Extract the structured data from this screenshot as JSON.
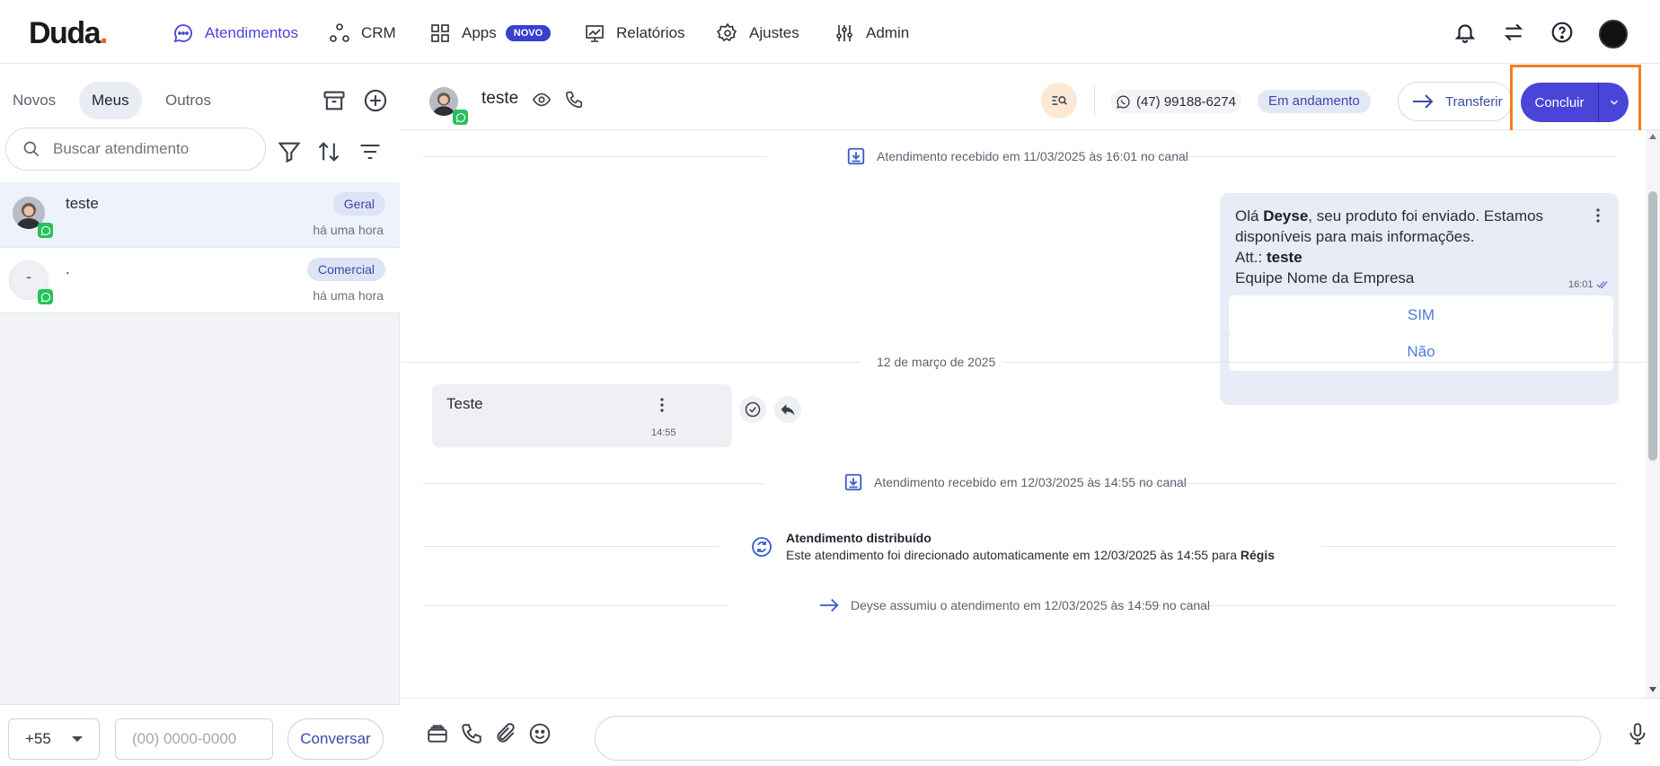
{
  "brand": {
    "name": "Duda",
    "dot": "."
  },
  "nav": {
    "atendimentos": "Atendimentos",
    "crm": "CRM",
    "apps": "Apps",
    "apps_badge": "NOVO",
    "relatorios": "Relatórios",
    "ajustes": "Ajustes",
    "admin": "Admin"
  },
  "colors": {
    "accent": "#4a45d9",
    "whatsapp": "#27c25b",
    "highlight": "#f47b20"
  },
  "sidebar": {
    "tabs": [
      "Novos",
      "Meus",
      "Outros"
    ],
    "active_tab": "Meus",
    "search_placeholder": "Buscar atendimento",
    "contacts": [
      {
        "name": "teste",
        "tag": "Geral",
        "time": "há uma hora",
        "avatar_initial": ""
      },
      {
        "name": ".",
        "tag": "Comercial",
        "time": "há uma hora",
        "avatar_initial": "-"
      }
    ],
    "country_code": "+55",
    "phone_placeholder": "(00) 0000-0000",
    "conversar": "Conversar"
  },
  "chat_header": {
    "contact_name": "teste",
    "phone": "(47) 99188-6274",
    "status": "Em andamento",
    "transfer_label": "Transferir",
    "conclude_label": "Concluir"
  },
  "messages": {
    "sys1": "Atendimento recebido em 11/03/2025 às 16:01 no canal",
    "out_greeting": "Olá ",
    "out_name": "Deyse",
    "out_rest": ", seu produto foi enviado. Estamos disponíveis para mais informações.",
    "out_att": "Att.: ",
    "out_att_name": "teste",
    "out_company": "Equipe Nome da Empresa",
    "out_time": "16:01",
    "option_yes": "SIM",
    "option_no": "Não",
    "date_divider": "12 de março de 2025",
    "in_text": "Teste",
    "in_time": "14:55",
    "sys2": "Atendimento recebido em 12/03/2025 às 14:55 no canal",
    "dist_title": "Atendimento distribuído",
    "dist_text": "Este atendimento foi direcionado automaticamente em 12/03/2025 às 14:55 para ",
    "dist_agent": "Régis",
    "sys3": "Deyse assumiu o atendimento em 12/03/2025 às 14:59 no canal"
  }
}
